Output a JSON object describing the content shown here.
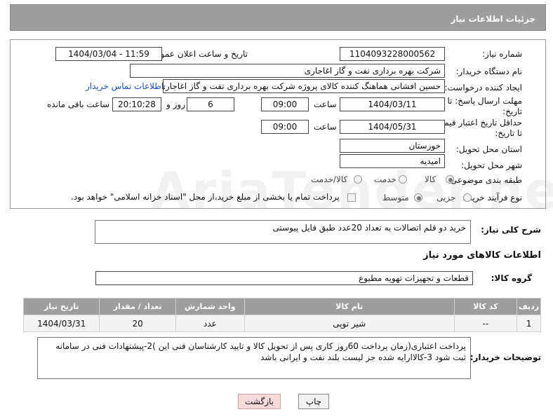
{
  "header": {
    "title": "جزئیات اطلاعات نیاز"
  },
  "need_number": {
    "label": "شماره نیاز:",
    "value": "1104093228000562"
  },
  "announce_datetime": {
    "label": "تاریخ و ساعت اعلان عمومی:",
    "value": "1404/03/04 - 11:59"
  },
  "buyer_org": {
    "label": "نام دستگاه خریدار:",
    "value": "شرکت بهره برداری نفت و گاز اغاجاری"
  },
  "requester": {
    "label": "ایجاد کننده درخواست:",
    "value": "حسین افشانی هماهنگ کننده کالای پروژه شرکت بهره برداری نفت و گاز اغاجاری",
    "contact_link": "اطلاعات تماس خریدار"
  },
  "reply_deadline": {
    "label_line1": "مهلت ارسال پاسخ: تا",
    "label_line2": "تاریخ:",
    "date": "1404/03/11",
    "time_label": "ساعت",
    "time": "09:00",
    "days": "6",
    "days_label": "روز و",
    "remaining": "20:10:28",
    "remaining_label": "ساعت باقی مانده"
  },
  "price_validity": {
    "label_line1": "حداقل تاریخ اعتبار قیمت:",
    "label_line2": "تا تاریخ:",
    "date": "1404/05/31",
    "time_label": "ساعت",
    "time": "09:00"
  },
  "delivery_province": {
    "label": "استان محل تحویل:",
    "value": "خوزستان"
  },
  "delivery_city": {
    "label": "شهر محل تحویل:",
    "value": "امیدیه"
  },
  "category": {
    "label": "طبقه بندی موضوعی:",
    "options": [
      "کالا",
      "خدمت",
      "کالا/خدمت"
    ],
    "selected": "کالا"
  },
  "purchase_process": {
    "label": "نوع فرآیند خرید :",
    "options": [
      "جزیی",
      "متوسط"
    ],
    "selected": "متوسط",
    "payment_note": "پرداخت تمام یا بخشی از مبلغ خرید،از محل \"اسناد خزانه اسلامی\" خواهد بود."
  },
  "general_desc": {
    "label": "شرح کلی نیاز:",
    "value": "خرید دو قلم اتصالات به تعداد 20عدد طبق فایل پیوستی"
  },
  "goods_info": {
    "title": "اطلاعات کالاهای مورد نیاز"
  },
  "goods_group": {
    "label": "گروه کالا:",
    "value": "قطعات و تجهیزات تهویه مطبوع"
  },
  "table": {
    "headers": [
      "ردیف",
      "کد کالا",
      "نام کالا",
      "واحد شمارش",
      "تعداد / مقدار",
      "تاریخ نیاز"
    ],
    "rows": [
      [
        "1",
        "--",
        "شیر توپی",
        "عدد",
        "20",
        "1404/03/31"
      ]
    ]
  },
  "buyer_notes": {
    "label": "توضیحات خریدار:",
    "value": "پرداخت اعتباری(زمان پرداخت 60روز کاری پس از تحویل کالا و تایید کارشناسان فنی این )2-پیشنهادات فنی در سامانه ثبت شود 3-کالاارایه شده جز لیست بلند نفت و ایرانی باشد"
  },
  "buttons": {
    "print": "چاپ",
    "back": "بازگشت"
  },
  "watermark": "AriaTender.neT"
}
